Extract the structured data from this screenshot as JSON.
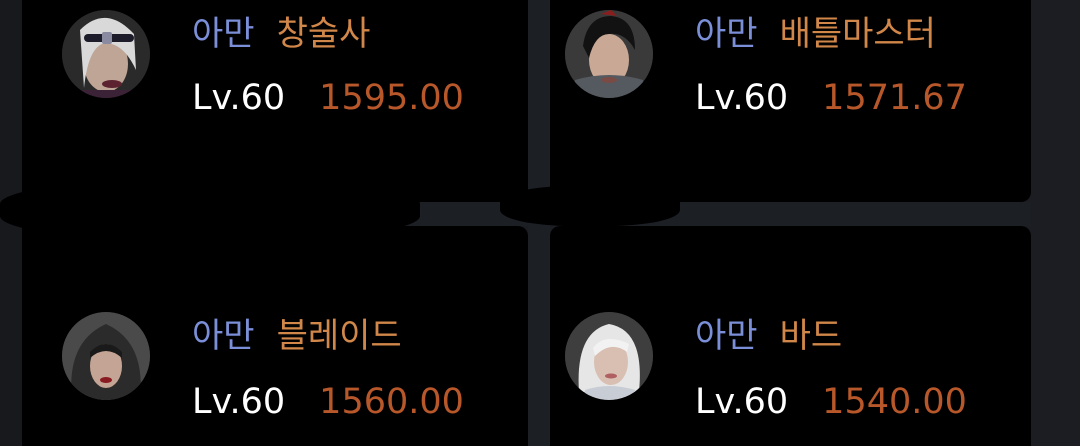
{
  "characters": [
    {
      "server": "아만",
      "job": "창술사",
      "level": "Lv.60",
      "score": "1595.00",
      "avatar": "female-lancer-portrait"
    },
    {
      "server": "아만",
      "job": "배틀마스터",
      "level": "Lv.60",
      "score": "1571.67",
      "avatar": "male-battlemaster-portrait"
    },
    {
      "server": "아만",
      "job": "블레이드",
      "level": "Lv.60",
      "score": "1560.00",
      "avatar": "hooded-blade-portrait"
    },
    {
      "server": "아만",
      "job": "바드",
      "level": "Lv.60",
      "score": "1540.00",
      "avatar": "white-haired-bard-portrait"
    }
  ],
  "colors": {
    "server": "#7b8fd8",
    "job": "#d1874a",
    "level": "#ffffff",
    "score": "#b8582a",
    "card": "#000000",
    "background": "#1b1d22"
  }
}
